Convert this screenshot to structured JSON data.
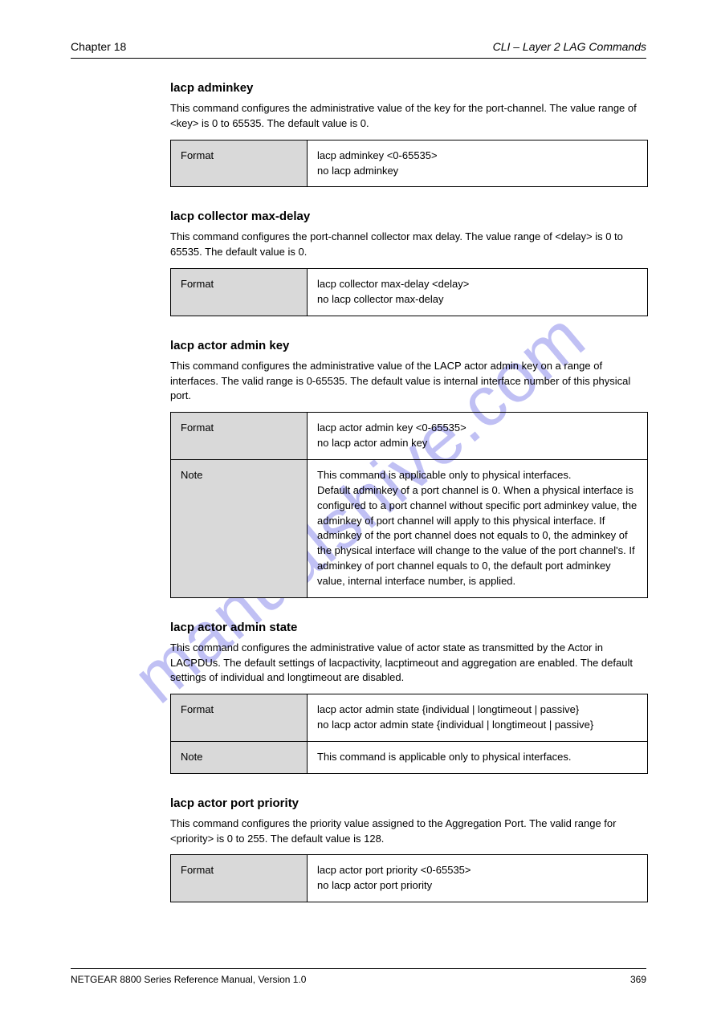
{
  "header": {
    "left": "Chapter 18",
    "right": "CLI – Layer 2 LAG Commands"
  },
  "sections": [
    {
      "title": "lacp adminkey",
      "desc": "This command configures the administrative value of the key for the port-channel. The value range of <key> is 0 to 65535. The default value is 0.",
      "rows": [
        {
          "label": "Format",
          "value": "lacp adminkey <0-65535>\nno lacp adminkey"
        }
      ]
    },
    {
      "title": "lacp collector max-delay",
      "desc": "This command configures the port-channel collector max delay. The value range of <delay> is 0 to 65535. The default value is 0.",
      "rows": [
        {
          "label": "Format",
          "value": "lacp collector max-delay <delay>\nno lacp collector max-delay"
        }
      ]
    },
    {
      "title": "lacp actor admin key",
      "desc": "This command configures the administrative value of the LACP actor admin key on a range of interfaces. The valid range is 0-65535. The default value is internal interface number of this physical port.",
      "rows": [
        {
          "label": "Format",
          "value": "lacp actor admin key <0-65535>\nno lacp actor admin key"
        },
        {
          "label": "Note",
          "value": "This command is applicable only to physical interfaces.\nDefault adminkey of a port channel is 0. When a physical interface is configured to a port channel without specific port adminkey value, the adminkey of port channel will apply to this physical interface. If adminkey of the port channel does not equals to 0, the adminkey of the physical interface will change to the value of the port channel's. If adminkey of port channel equals to 0, the default port adminkey value, internal interface number, is applied."
        }
      ]
    },
    {
      "title": "lacp actor admin state",
      "desc": "This command configures the administrative value of actor state as transmitted by the Actor in LACPDUs. The default settings of lacpactivity, lacptimeout and aggregation are enabled. The default settings of individual and longtimeout are disabled.",
      "rows": [
        {
          "label": "Format",
          "value": "lacp actor admin state {individual | longtimeout | passive}\nno lacp actor admin state {individual | longtimeout | passive}"
        },
        {
          "label": "Note",
          "value": "This command is applicable only to physical interfaces."
        }
      ]
    },
    {
      "title": "lacp actor port priority",
      "desc": "This command configures the priority value assigned to the Aggregation Port. The valid range for <priority> is 0 to 255. The default value is 128.",
      "rows": [
        {
          "label": "Format",
          "value": "lacp actor port priority <0-65535>\nno lacp actor port priority"
        }
      ]
    }
  ],
  "footer": {
    "left": "NETGEAR 8800 Series Reference Manual, Version 1.0",
    "right": "369"
  },
  "watermark": "manualshive.com"
}
